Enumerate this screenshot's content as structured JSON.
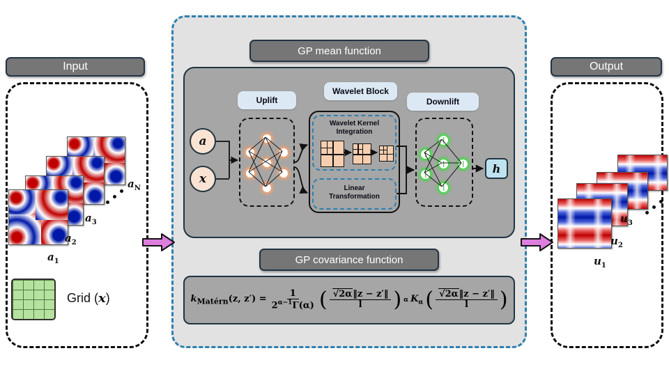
{
  "panels": {
    "input": {
      "header": "Input"
    },
    "output": {
      "header": "Output"
    }
  },
  "input_fields": {
    "labels": [
      "a",
      "a",
      "a",
      "a"
    ],
    "subscripts": [
      "1",
      "2",
      "3",
      "N"
    ],
    "grid_label_text": "Grid (",
    "grid_label_var": "x",
    "grid_label_close": ")",
    "grid_rows": 4,
    "grid_cols": 4
  },
  "output_fields": {
    "labels": [
      "u",
      "u",
      "u"
    ],
    "subscripts": [
      "1",
      "2",
      "3"
    ]
  },
  "center": {
    "mean_title": "GP mean function",
    "cov_title": "GP covariance function",
    "blocks": {
      "uplift": "Uplift",
      "wavelet": "Wavelet Block",
      "downlift": "Downlift",
      "wavelet_kernel_integration": "Wavelet Kernel\nIntegration",
      "wavelet_kernel_integration_line1": "Wavelet Kernel",
      "wavelet_kernel_integration_line2": "Integration",
      "linear_transformation_line1": "Linear",
      "linear_transformation_line2": "Transformation"
    },
    "inputs": {
      "a": "a",
      "x": "x"
    },
    "output": {
      "h": "h"
    },
    "formula": {
      "lhs_k": "k",
      "lhs_sub": "Matérn",
      "lhs_args": "(z, z′) =",
      "frac_num": "1",
      "frac_den_base": "2",
      "frac_den_exp": "α−1",
      "frac_den_gamma": "Γ(α)",
      "inner_num_radical": "2α",
      "inner_num_norm": "‖z − z′‖",
      "inner_den": "l",
      "power": "α",
      "bessel": "K",
      "bessel_sub": "α",
      "full_text": "k_Matérn(z, z') = 1/(2^(α−1)Γ(α)) (√(2α)||z − z'||/l)^α K_α(√(2α)||z − z'||/l)"
    },
    "node_counts": {
      "uplift": [
        2,
        3,
        2
      ],
      "downlift": [
        2,
        3,
        1
      ]
    },
    "wavelet_steps": 3
  },
  "colors": {
    "panel_fill": "#e2e2e2",
    "panel_border": "#2d7fb0",
    "title_bar": "#767676",
    "title_border": "#223344",
    "inner_body": "#a6a6a6",
    "pill_fill": "#dce9f5",
    "node_orange_glow": "#ffa36b",
    "node_green_glow": "#35e035",
    "io_circle_fill": "#fbe3d4",
    "h_box_fill": "#bfe2f0",
    "arrow_fill": "#dd7edd",
    "grid_fill": "#b6e2a0",
    "wavelet_fill": "#f7cfb0",
    "heat_hot": "#c00000",
    "heat_cold": "#0018a8"
  }
}
